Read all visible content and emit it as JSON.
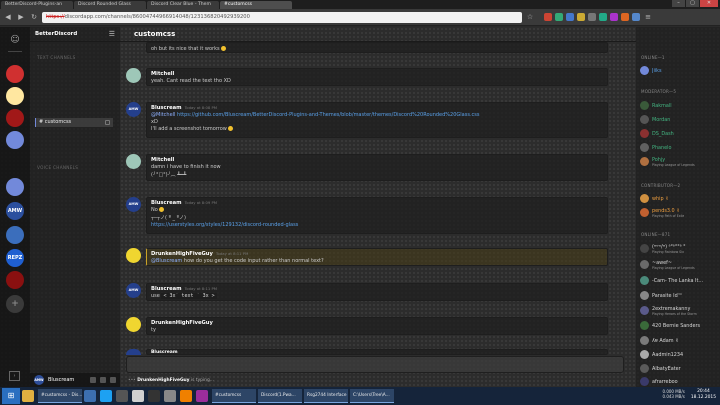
{
  "browser": {
    "tabs": [
      {
        "label": "BetterDiscord-Plugins-an"
      },
      {
        "label": "Discord Rounded Glass"
      },
      {
        "label": "Discord Clear Blue - Them"
      },
      {
        "label": "#customcss",
        "active": true
      }
    ],
    "url_protocol": "https://",
    "url_rest": "discordapp.com/channels/86004744966914048/123136820492939200",
    "window_controls": [
      "–",
      "▢",
      "✕"
    ]
  },
  "guilds": [
    {
      "label": "",
      "color": "#d03030"
    },
    {
      "label": "",
      "color": "#ffe7a0"
    },
    {
      "label": "",
      "color": "#a11818"
    },
    {
      "label": "",
      "color": "#7289da"
    },
    {
      "label": "",
      "color": "#7289da"
    },
    {
      "label": "AMW",
      "color": "#2b4f9e"
    },
    {
      "label": "",
      "color": "#3b6ebc"
    },
    {
      "label": "REPZ",
      "color": "#1f5fd1"
    },
    {
      "label": "",
      "color": "#8a1010"
    }
  ],
  "add_server_label": "+",
  "sidebar": {
    "server_name": "BetterDiscord",
    "text_channels_label": "TEXT CHANNELS",
    "active_channel": "# customcss",
    "voice_channels_label": "VOICE CHANNELS",
    "user": {
      "name": "Bluscream",
      "avatar_label": "AMW"
    }
  },
  "chat": {
    "channel_name": "customcss",
    "messages": [
      {
        "author": "",
        "time": "",
        "lines": [
          "oh but its nice that it works"
        ],
        "emoji": true
      },
      {
        "author": "Mitchell",
        "time": "",
        "lines": [
          "yeah. Cant read the text tho XD"
        ]
      },
      {
        "author": "Bluscream",
        "time": "Today at 8:08 PM",
        "mention": "@Mitchell",
        "link": "https://github.com/Bluscream/BetterDiscord-Plugins-and-Themes/blob/master/themes/Discord%20Rounded%20Glass.css",
        "lines": [
          "xD",
          "I'll add a screenshot tomorrow"
        ],
        "emoji": true
      },
      {
        "author": "Mitchell",
        "time": "",
        "lines": [
          "damn i have to finish it now",
          "(╯°□°)╯︵ ┻━┻"
        ]
      },
      {
        "author": "Bluscream",
        "time": "Today at 8:09 PM",
        "lines": [
          "No",
          "┬─┬ノ( º _ ºノ)"
        ],
        "link2": "https://userstyles.org/styles/129132/discord-rounded-glass",
        "emoji": true
      },
      {
        "author": "DrunkenHighFiveGuy",
        "time": "Today at 8:11 PM",
        "mention": "@Bluscream",
        "lines": [
          "how do you get the code input rather than normal text?"
        ],
        "highlight": true
      },
      {
        "author": "Bluscream",
        "time": "Today at 8:11 PM",
        "code_prefix": "use",
        "code": "< 3x` text ` 3x >"
      },
      {
        "author": "DrunkenHighFiveGuy",
        "time": "",
        "lines": [
          "ty"
        ]
      },
      {
        "author": "Bluscream",
        "time": "",
        "lines": []
      }
    ],
    "typing_user": "DrunkenHighFiveGuy",
    "typing_suffix": " is typing..."
  },
  "members": {
    "categories": [
      {
        "label": "ONLINE—1",
        "members": [
          {
            "name": "Jiiks",
            "color": "#5aa0e8",
            "game": ""
          }
        ]
      },
      {
        "label": "MODERATOR—5",
        "members": [
          {
            "name": "Rakmall",
            "color": "#43b581",
            "game": ""
          },
          {
            "name": "Mordan",
            "color": "#43b581",
            "game": ""
          },
          {
            "name": "DS_Dash",
            "color": "#43b581",
            "game": ""
          },
          {
            "name": "Phanelo",
            "color": "#43b581",
            "game": ""
          },
          {
            "name": "Pohjy",
            "color": "#43b581",
            "game": "Playing League of Legends"
          }
        ]
      },
      {
        "label": "CONTRIBUTOR—2",
        "members": [
          {
            "name": "whip ✌",
            "color": "#f0a040",
            "game": ""
          },
          {
            "name": "pends3.0 ✌",
            "color": "#f0a040",
            "game": "Playing Path of Exile"
          }
        ]
      },
      {
        "label": "ONLINE—871",
        "members": [
          {
            "name": "(ʷᵒʷ/ʷ) ᵟ°ᵟ°°ᵟ °",
            "color": "#ffffff",
            "game": "Playing Rainbow Six"
          },
          {
            "name": "~awef~",
            "color": "#ffffff",
            "game": "Playing League of Legends"
          },
          {
            "name": "-Cam- The Lanka It...",
            "color": "#ffffff",
            "game": ""
          },
          {
            "name": "Parasite Id™",
            "color": "#ffffff",
            "game": ""
          },
          {
            "name": "2extremakanny",
            "color": "#ffffff",
            "game": "Playing Heroes of the Storm"
          },
          {
            "name": "420 Bernie Sanders",
            "color": "#ffffff",
            "game": ""
          },
          {
            "name": "ʎɐ Adam ✌",
            "color": "#ffffff",
            "game": ""
          },
          {
            "name": "Aadmin1234",
            "color": "#ffffff",
            "game": ""
          },
          {
            "name": "AlbatyEater",
            "color": "#ffffff",
            "game": ""
          },
          {
            "name": "afrarreboo",
            "color": "#ffffff",
            "game": ""
          }
        ]
      }
    ]
  },
  "taskbar": {
    "windows": [
      {
        "label": "#customcss - Dis..."
      },
      {
        "label": "#customcss"
      },
      {
        "label": "Discord(1.Pwa..."
      },
      {
        "label": "Rsg2744 Interface"
      },
      {
        "label": "C:\\Users\\Tree\\A..."
      }
    ],
    "tray_up": "0.000 MB/s",
    "tray_down": "0.043 MB/s",
    "time": "20:44",
    "date": "18.12.2015"
  }
}
